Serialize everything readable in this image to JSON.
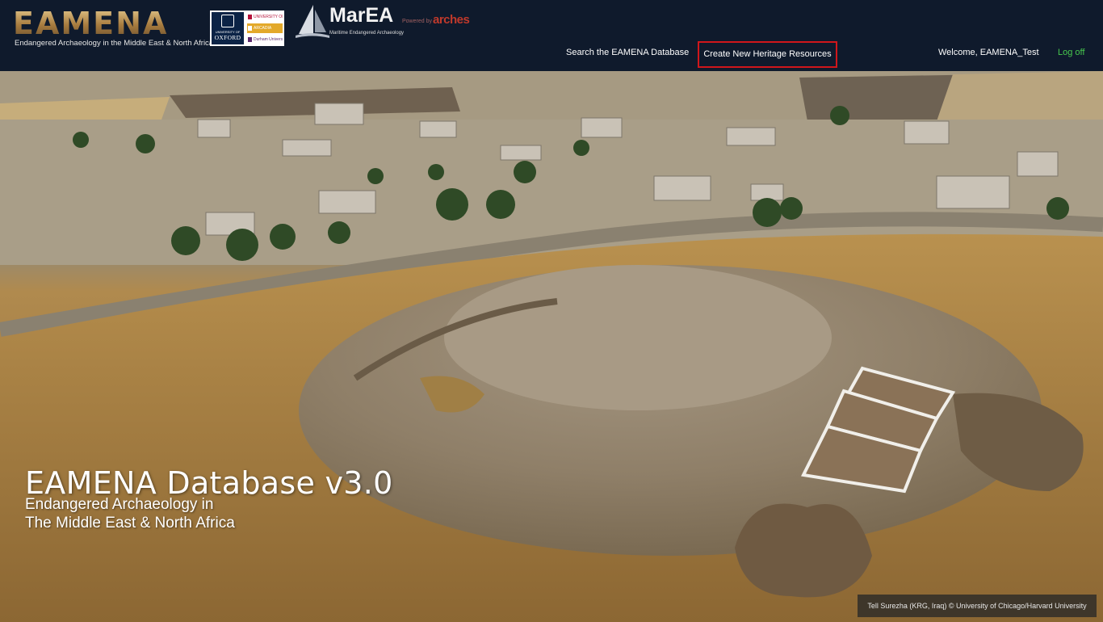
{
  "header": {
    "logo_text": "EAMENA",
    "logo_tagline": "Endangered Archaeology in the Middle East & North Africa",
    "partners": {
      "oxford_small": "UNIVERSITY OF",
      "oxford": "OXFORD",
      "leicester": "UNIVERSITY OF LEICESTER",
      "arcadia": "ARCADIA",
      "durham": "Durham University"
    },
    "marea": {
      "title": "MarEA",
      "subtitle": "Maritime Endangered Archaeology",
      "powered_by": "Powered by",
      "arches": "arches"
    },
    "nav": {
      "search": "Search the EAMENA Database",
      "create": "Create New Heritage Resources"
    },
    "welcome": "Welcome, EAMENA_Test",
    "logoff": "Log off"
  },
  "hero": {
    "title": "EAMENA Database v3.0",
    "subtitle_line1": "Endangered Archaeology in",
    "subtitle_line2": "The Middle East & North Africa",
    "caption": "Tell Surezha (KRG, Iraq) © University of Chicago/Harvard University"
  },
  "colors": {
    "header_bg": "#0f1a2c",
    "highlight_border": "#d0161b",
    "logoff": "#47c84e"
  }
}
